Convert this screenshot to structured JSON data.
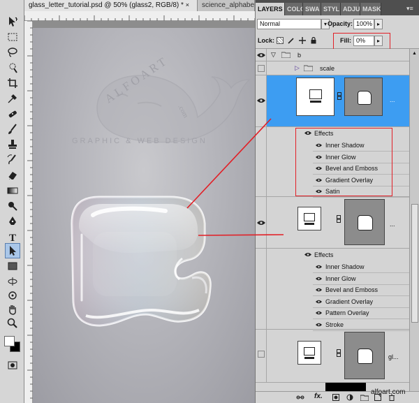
{
  "tabs": {
    "active": "glass_letter_tutorial.psd @ 50% (glass2, RGB/8) *",
    "inactive": "science_alphabet"
  },
  "panel_tabs": [
    "LAYERS",
    "COLO",
    "SWA",
    "STYL",
    "ADJU",
    "MASK"
  ],
  "options": {
    "blend_mode": "Normal",
    "opacity_label": "Opacity:",
    "opacity_value": "100%",
    "lock_label": "Lock:",
    "fill_label": "Fill:",
    "fill_value": "0%"
  },
  "layers": {
    "group_b": "b",
    "group_scale": "scale",
    "layer1_effects_label": "Effects",
    "layer1_effects": [
      "Inner Shadow",
      "Inner Glow",
      "Bevel and Emboss",
      "Gradient Overlay",
      "Satin"
    ],
    "layer2_effects_label": "Effects",
    "layer2_effects": [
      "Inner Shadow",
      "Inner Glow",
      "Bevel and Emboss",
      "Gradient Overlay",
      "Pattern Overlay",
      "Stroke"
    ],
    "layer3_name": "gl..."
  },
  "canvas": {
    "watermark_brand": "ALFOART",
    "watermark_suffix": ".com",
    "watermark_tagline": "GRAPHIC & WEB DESIGN"
  },
  "footer_credit": "alfoart.com",
  "colors": {
    "selection_blue": "#3d9df2",
    "highlight_red": "#e21f26",
    "panel_gray": "#d4d4d4"
  }
}
